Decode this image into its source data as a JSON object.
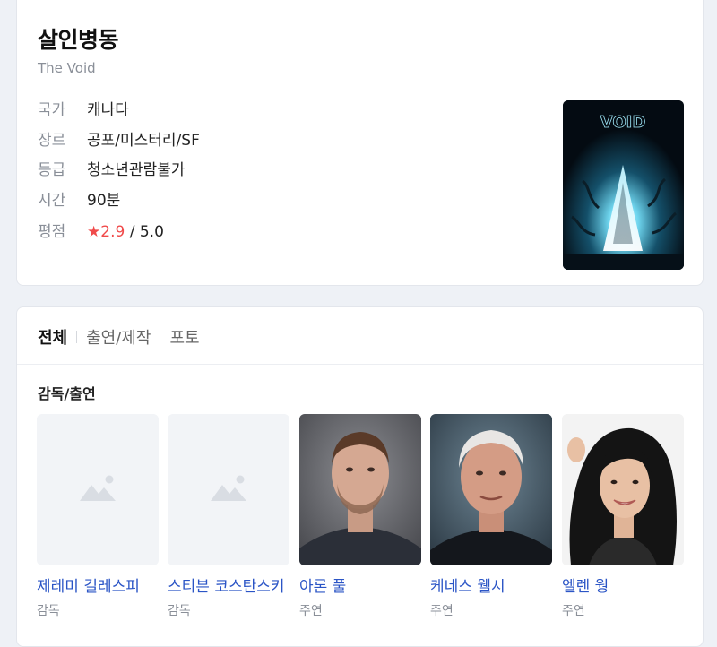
{
  "movie": {
    "title": "살인병동",
    "subtitle": "The Void",
    "info": [
      {
        "label": "국가",
        "value": "캐나다"
      },
      {
        "label": "장르",
        "value": "공포/미스터리/SF"
      },
      {
        "label": "등급",
        "value": "청소년관람불가"
      },
      {
        "label": "시간",
        "value": "90분"
      }
    ],
    "rating": {
      "label": "평점",
      "star": "★",
      "score": "2.9",
      "separator": " / ",
      "max": "5.0"
    },
    "poster": {
      "text": "VOID"
    }
  },
  "tabs": [
    {
      "label": "전체",
      "active": true
    },
    {
      "label": "출연/제작",
      "active": false
    },
    {
      "label": "포토",
      "active": false
    }
  ],
  "cast_section": {
    "title": "감독/출연",
    "people": [
      {
        "name": "제레미 길레스피",
        "role": "감독",
        "photo": "placeholder"
      },
      {
        "name": "스티븐 코스탄스키",
        "role": "감독",
        "photo": "placeholder"
      },
      {
        "name": "아론 풀",
        "role": "주연",
        "photo": "man-beard"
      },
      {
        "name": "케네스 웰시",
        "role": "주연",
        "photo": "older-man"
      },
      {
        "name": "엘렌 웡",
        "role": "주연",
        "photo": "woman"
      }
    ]
  },
  "colors": {
    "link": "#2b55c6",
    "rating": "#f04a4a",
    "background": "#eef1f6"
  }
}
